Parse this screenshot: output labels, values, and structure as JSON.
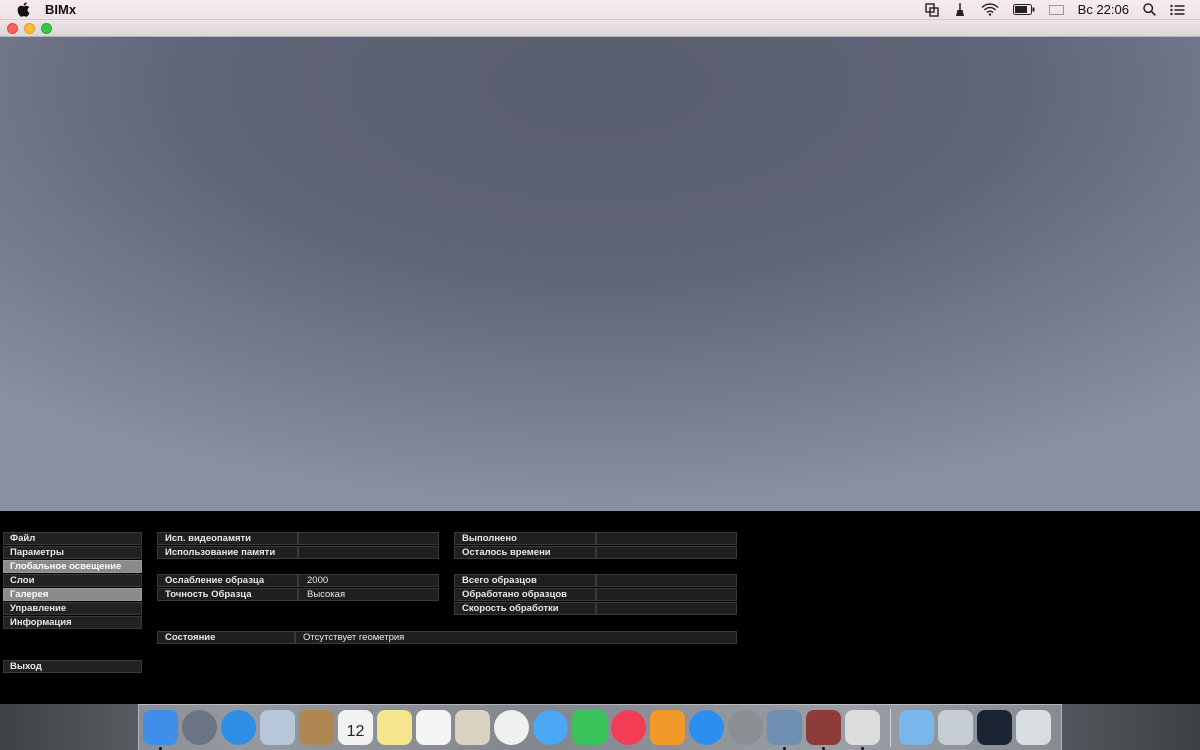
{
  "menubar": {
    "app_name": "BIMx",
    "clock": "Вс 22:06",
    "flag_colors": [
      "#ffffff",
      "#1f3fb7",
      "#d4202a"
    ]
  },
  "window": {
    "close_color": "#fc5f57",
    "minimize_color": "#fdbc2e",
    "maximize_color": "#33c748"
  },
  "panel": {
    "menu": [
      {
        "label": "Файл",
        "active": false
      },
      {
        "label": "Параметры",
        "active": false
      },
      {
        "label": "Глобальное освещение",
        "active": true
      },
      {
        "label": "Слои",
        "active": false
      },
      {
        "label": "Галерея",
        "active": true
      },
      {
        "label": "Управление",
        "active": false
      },
      {
        "label": "Информация",
        "active": false
      }
    ],
    "exit_label": "Выход",
    "left_rows": [
      {
        "label": "Исп. видеопамяти",
        "value": ""
      },
      {
        "label": "Использование памяти",
        "value": ""
      },
      {
        "label": "Ослабление образца",
        "value": "2000"
      },
      {
        "label": "Точность Образца",
        "value": "Высокая"
      }
    ],
    "right_rows": [
      {
        "label": "Выполнено",
        "value": ""
      },
      {
        "label": "Осталось времени",
        "value": ""
      },
      {
        "label": "Всего образцов",
        "value": ""
      },
      {
        "label": "Обработано образцов",
        "value": ""
      },
      {
        "label": "Скорость обработки",
        "value": ""
      }
    ],
    "status": {
      "label": "Состояние",
      "value": "Отсутствует геометрия"
    }
  },
  "dock": {
    "apps": [
      {
        "name": "finder-icon",
        "color": "#3f8ee8",
        "running": true
      },
      {
        "name": "launchpad-icon",
        "color": "#6a7482",
        "running": false
      },
      {
        "name": "safari-icon",
        "color": "#2f8fe6",
        "running": false
      },
      {
        "name": "mail-icon",
        "color": "#b7c6d8",
        "running": false
      },
      {
        "name": "contacts-icon",
        "color": "#b08653",
        "running": false
      },
      {
        "name": "calendar-icon",
        "color": "#f2f2f2",
        "running": false,
        "text": "12"
      },
      {
        "name": "notes-icon",
        "color": "#f6e58d",
        "running": false
      },
      {
        "name": "reminders-icon",
        "color": "#f5f5f5",
        "running": false
      },
      {
        "name": "preview-icon",
        "color": "#d9d2c0",
        "running": false
      },
      {
        "name": "photos-icon",
        "color": "#f0f0f0",
        "running": false
      },
      {
        "name": "messages-icon",
        "color": "#4aa8f5",
        "running": false
      },
      {
        "name": "facetime-icon",
        "color": "#3cc25a",
        "running": false
      },
      {
        "name": "itunes-icon",
        "color": "#f23d54",
        "running": false
      },
      {
        "name": "ibooks-icon",
        "color": "#f19a2a",
        "running": false
      },
      {
        "name": "app-store-icon",
        "color": "#2c8ef0",
        "running": false
      },
      {
        "name": "system-preferences-icon",
        "color": "#8b8f94",
        "running": false
      },
      {
        "name": "image-viewer-icon",
        "color": "#6f8fb0",
        "running": true
      },
      {
        "name": "archicad-icon",
        "color": "#8e3b3b",
        "running": true
      },
      {
        "name": "bimx-icon",
        "color": "#dcdcdc",
        "running": true
      }
    ],
    "stacks": [
      {
        "name": "applications-folder-icon",
        "color": "#79b6ec"
      },
      {
        "name": "documents-stack-icon",
        "color": "#c7cdd4"
      },
      {
        "name": "desktop-stack-icon",
        "color": "#1a2433"
      },
      {
        "name": "trash-icon",
        "color": "#d8dde2"
      }
    ]
  }
}
